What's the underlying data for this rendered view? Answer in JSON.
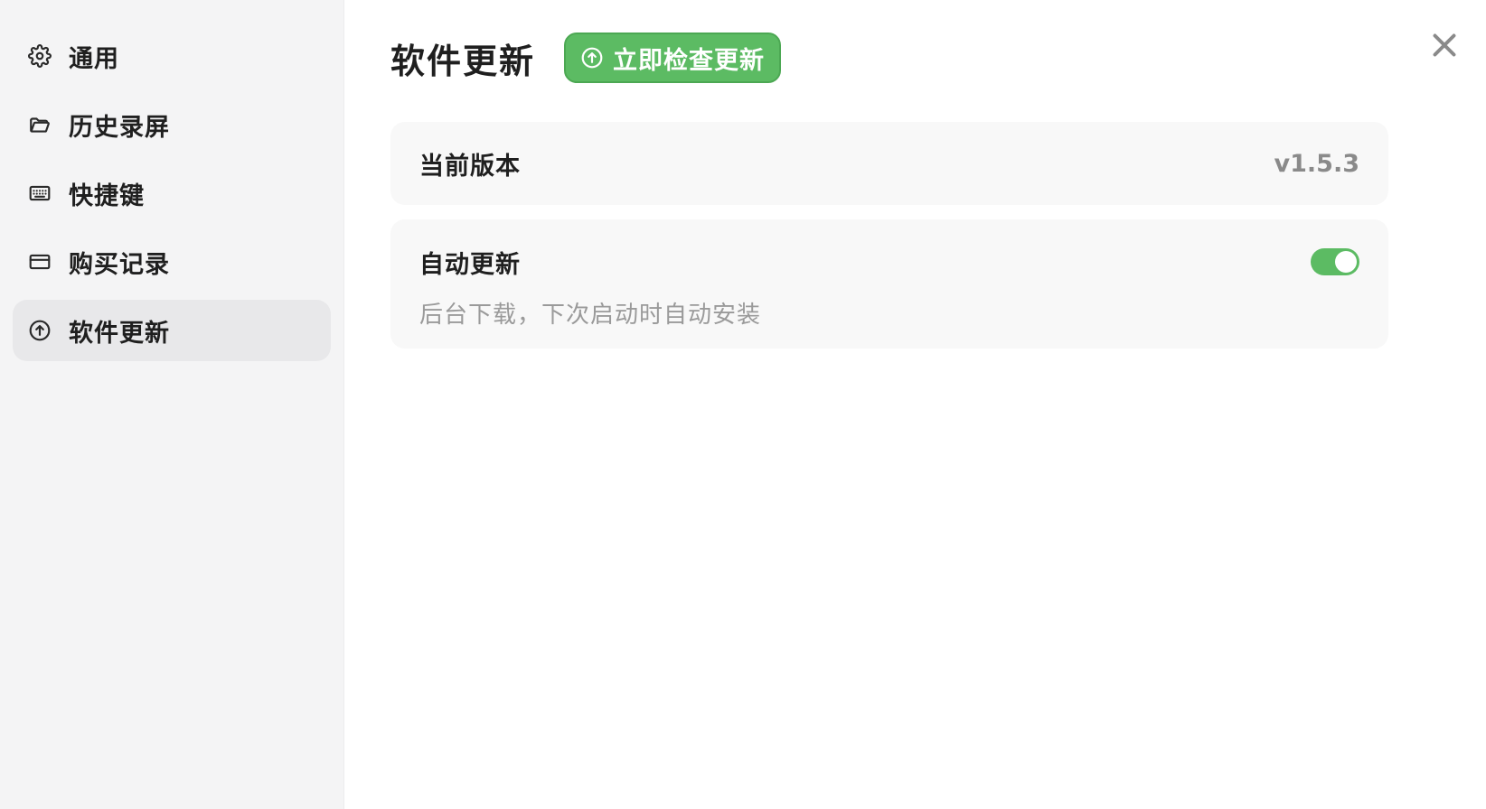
{
  "sidebar": {
    "items": [
      {
        "label": "通用",
        "icon": "gear-icon"
      },
      {
        "label": "历史录屏",
        "icon": "folder-open-icon"
      },
      {
        "label": "快捷键",
        "icon": "keyboard-icon"
      },
      {
        "label": "购买记录",
        "icon": "credit-card-icon"
      },
      {
        "label": "软件更新",
        "icon": "arrow-up-circle-icon",
        "active": true
      }
    ]
  },
  "main": {
    "title": "软件更新",
    "check_button_label": "立即检查更新",
    "version_card": {
      "label": "当前版本",
      "value": "v1.5.3"
    },
    "auto_update_card": {
      "label": "自动更新",
      "description": "后台下载，下次启动时自动安装",
      "enabled": true
    }
  },
  "colors": {
    "accent": "#5cbb63",
    "sidebar_bg": "#f4f4f5",
    "active_item_bg": "#e8e8ea",
    "card_bg": "#f8f8f8"
  }
}
